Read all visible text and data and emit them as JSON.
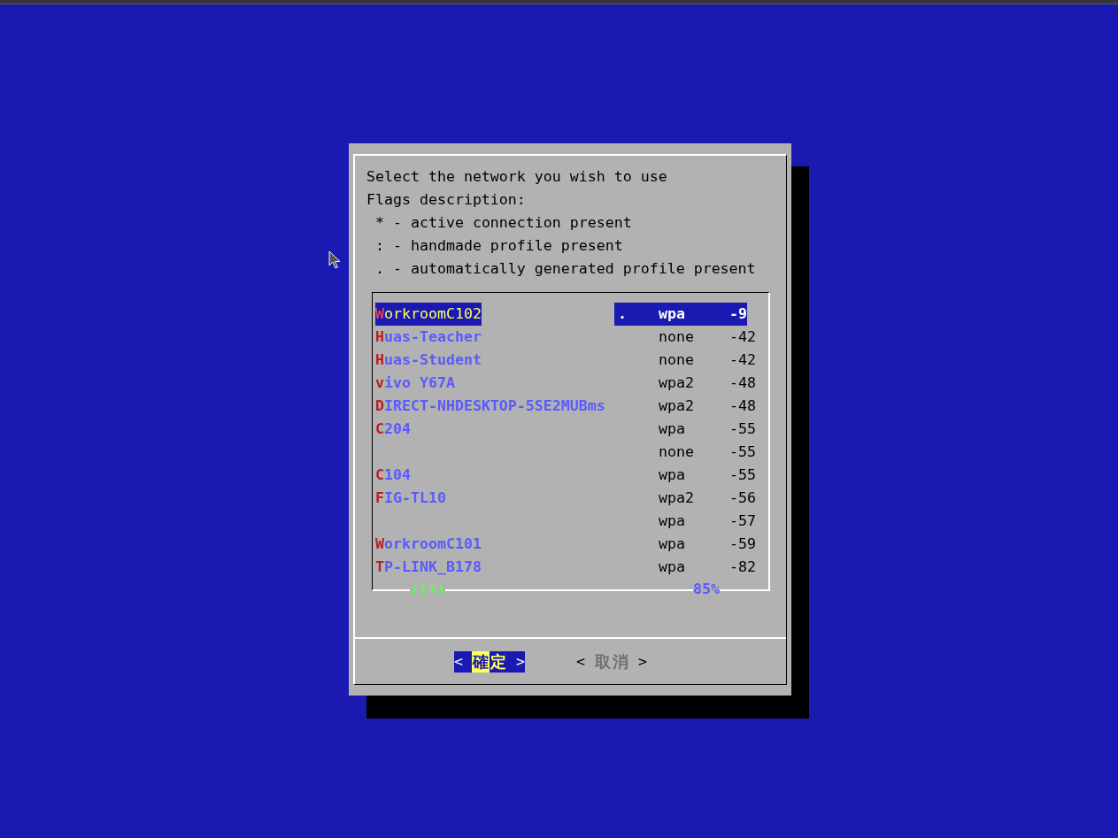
{
  "dialog": {
    "message": {
      "prompt": "Select the network you wish to use",
      "flags_heading": "Flags description:",
      "flags": [
        "* - active connection present",
        ": - handmade profile present",
        ". - automatically generated profile present"
      ]
    },
    "networks": [
      {
        "name": "WorkroomC102",
        "flag": ".",
        "security": "wpa",
        "signal": "-9",
        "selected": true
      },
      {
        "name": "Huas-Teacher",
        "security": "none",
        "signal": "-42",
        "selected": false
      },
      {
        "name": "Huas-Student",
        "security": "none",
        "signal": "-42",
        "selected": false
      },
      {
        "name": "vivo Y67A",
        "security": "wpa2",
        "signal": "-48",
        "selected": false
      },
      {
        "name": "DIRECT-NHDESKTOP-5SE2MUBms",
        "security": "wpa2",
        "signal": "-48",
        "selected": false
      },
      {
        "name": "C204",
        "security": "wpa",
        "signal": "-55",
        "selected": false
      },
      {
        "security": "none",
        "signal": "-55",
        "selected": false
      },
      {
        "name": "C104",
        "security": "wpa",
        "signal": "-55",
        "selected": false
      },
      {
        "name": "FIG-TL10",
        "security": "wpa2",
        "signal": "-56",
        "selected": false
      },
      {
        "security": "wpa",
        "signal": "-57",
        "selected": false
      },
      {
        "name": "WorkroomC101",
        "security": "wpa",
        "signal": "-59",
        "selected": false
      },
      {
        "name": "TP-LINK_B178",
        "security": "wpa",
        "signal": "-82",
        "selected": false
      }
    ],
    "scroll_more": "↓(+)",
    "scroll_percent": "85%",
    "buttons": [
      {
        "left": "<",
        "label": "確定",
        "right": ">",
        "selected": true
      },
      {
        "left": "<",
        "label": "取消",
        "right": ">",
        "selected": false
      }
    ]
  }
}
